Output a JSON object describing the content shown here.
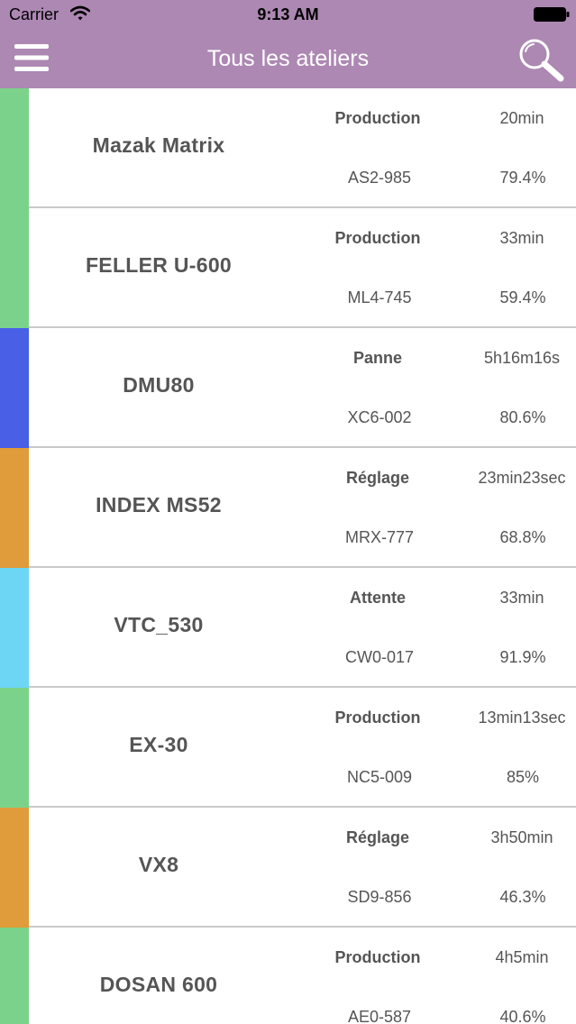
{
  "status_bar": {
    "carrier": "Carrier",
    "time": "9:13 AM",
    "wifi_icon": "wifi-icon",
    "battery_icon": "battery-icon"
  },
  "nav": {
    "title": "Tous les ateliers",
    "menu_icon": "hamburger-menu-icon",
    "search_icon": "search-icon"
  },
  "colors": {
    "header": "#ad88b3",
    "production": "#7bd38b",
    "panne": "#485fe6",
    "reglage": "#e09b3a",
    "attente": "#6dd6f4",
    "divider": "#c9c9c9",
    "text": "#555555"
  },
  "machines": [
    {
      "name": "Mazak Matrix",
      "state": "Production",
      "duration": "20min",
      "reference": "AS2-985",
      "rate": "79.4%",
      "color": "#7bd38b"
    },
    {
      "name": "FELLER U-600",
      "state": "Production",
      "duration": "33min",
      "reference": "ML4-745",
      "rate": "59.4%",
      "color": "#7bd38b"
    },
    {
      "name": "DMU80",
      "state": "Panne",
      "duration": "5h16m16s",
      "reference": "XC6-002",
      "rate": "80.6%",
      "color": "#485fe6"
    },
    {
      "name": "INDEX MS52",
      "state": "Réglage",
      "duration": "23min23sec",
      "reference": "MRX-777",
      "rate": "68.8%",
      "color": "#e09b3a"
    },
    {
      "name": "VTC_530",
      "state": "Attente",
      "duration": "33min",
      "reference": "CW0-017",
      "rate": "91.9%",
      "color": "#6dd6f4"
    },
    {
      "name": "EX-30",
      "state": "Production",
      "duration": "13min13sec",
      "reference": "NC5-009",
      "rate": "85%",
      "color": "#7bd38b"
    },
    {
      "name": "VX8",
      "state": "Réglage",
      "duration": "3h50min",
      "reference": "SD9-856",
      "rate": "46.3%",
      "color": "#e09b3a"
    },
    {
      "name": "DOSAN 600",
      "state": "Production",
      "duration": "4h5min",
      "reference": "AE0-587",
      "rate": "40.6%",
      "color": "#7bd38b"
    }
  ]
}
